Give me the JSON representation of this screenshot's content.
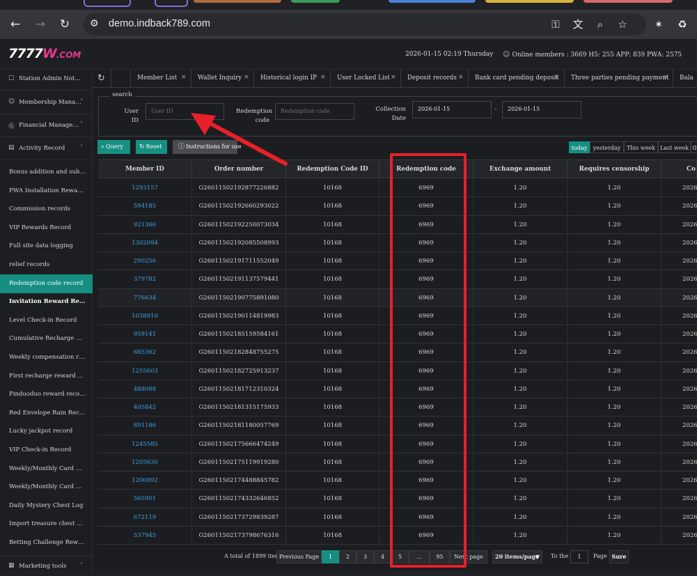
{
  "browser": {
    "url": "demo.indback789.com"
  },
  "header": {
    "logo_main": "7777",
    "logo_w": "W",
    "logo_com": ".COM",
    "datetime": "2026-01-15 02:19 Thursday",
    "online": "Online members : 3669  H5: 255 APP: 839 PWA: 2575"
  },
  "sidebar": {
    "top": [
      {
        "icon": "□",
        "label": "Station Admin Notice"
      },
      {
        "icon": "☺",
        "label": "Membership Manage...",
        "chev": "˅"
      },
      {
        "icon": "Ⓖ",
        "label": "Financial Management",
        "chev": "˅"
      },
      {
        "icon": "▤",
        "label": "Activity Record",
        "chev": "˄"
      }
    ],
    "items": [
      "Bonus addition and subtr...",
      "PWA Installation Reward ...",
      "Commission records",
      "VIP Rewards Record",
      "Full site data logging",
      "relief records",
      "Redemption code record",
      "Invitation Reward Record",
      "Level Check-in Record",
      "Cumulative Recharge Re...",
      "Weekly compensation rec...",
      "First recharge reward record",
      "Pinduoduo reward records",
      "Red Envelope Rain Record",
      "Lucky jackpot record",
      "VIP Check-in Record",
      "Weekly/Monthly Card Pu...",
      "Weekly/Monthly Card Cl...",
      "Daily Mystery Chest Log",
      "Import treasure chest clai...",
      "Betting Challenge Rewards"
    ],
    "bottom": {
      "icon": "▦",
      "label": "Marketing tools",
      "chev": "˅"
    }
  },
  "tabs": [
    {
      "label": "Member List",
      "close": "×"
    },
    {
      "label": "Wallet Inquiry",
      "close": "×"
    },
    {
      "label": "Historical login IP",
      "close": "×"
    },
    {
      "label": "User Locked List",
      "close": "×"
    },
    {
      "label": "Deposit records",
      "close": "×"
    },
    {
      "label": "Bank card pending deposit",
      "close": "×"
    },
    {
      "label": "Three parties pending payment",
      "close": "×"
    },
    {
      "label": "Bala",
      "close": ""
    }
  ],
  "search": {
    "legend": "search",
    "user_id_label": "User ID",
    "user_id_placeholder": "User ID",
    "redemption_label_1": "Redemption",
    "redemption_label_2": "code",
    "redemption_placeholder": "Redemption code",
    "collection_label_1": "Collection",
    "collection_label_2": "Date",
    "date_from": "2026-01-15",
    "date_sep": "-",
    "date_to": "2026-01-15"
  },
  "buttons": {
    "query": "Query",
    "reset": "Reset",
    "instructions": "Instructions for use"
  },
  "date_tabs": [
    "today",
    "yesterday",
    "This week",
    "Last week",
    "th"
  ],
  "table": {
    "headers": [
      "Member ID",
      "Order number",
      "Redemption Code ID",
      "Redemption code",
      "Exchange amount",
      "Requires censorship",
      "Co"
    ],
    "rows": [
      [
        "1293157",
        "G2601150219287722688​2",
        "10168",
        "6969",
        "1.20",
        "1.20",
        "2026-"
      ],
      [
        "594185",
        "G2601150219266029302​2",
        "10168",
        "6969",
        "1.20",
        "1.20",
        "2026-"
      ],
      [
        "921366",
        "G2601150219225007303​4",
        "10168",
        "6969",
        "1.20",
        "1.20",
        "2026-"
      ],
      [
        "1302094",
        "G2601150219208550899​3",
        "10168",
        "6969",
        "1.20",
        "1.20",
        "2026-"
      ],
      [
        "290256",
        "G2601150219171155204​9",
        "10168",
        "6969",
        "1.20",
        "1.20",
        "2026-"
      ],
      [
        "379782",
        "G2601150219113757944​1",
        "10168",
        "6969",
        "1.20",
        "1.20",
        "2026-"
      ],
      [
        "776634",
        "G2601150219077589108​0",
        "10168",
        "6969",
        "1.20",
        "1.20",
        "2026-"
      ],
      [
        "1038910",
        "G2601150219011481998​3",
        "10168",
        "6969",
        "1.20",
        "1.20",
        "2026-"
      ],
      [
        "959141",
        "G2601150218515958416​1",
        "10168",
        "6969",
        "1.20",
        "1.20",
        "2026-"
      ],
      [
        "685362",
        "G2601150218284875527​5",
        "10168",
        "6969",
        "1.20",
        "1.20",
        "2026-"
      ],
      [
        "1255603",
        "G2601150218272591323​7",
        "10168",
        "6969",
        "1.20",
        "1.20",
        "2026-"
      ],
      [
        "488088",
        "G2601150218171231032​4",
        "10168",
        "6969",
        "1.20",
        "1.20",
        "2026-"
      ],
      [
        "405842",
        "G2601150218131517593​3",
        "10168",
        "6969",
        "1.20",
        "1.20",
        "2026-"
      ],
      [
        "891186",
        "G2601150218118005776​9",
        "10168",
        "6969",
        "1.20",
        "1.20",
        "2026-"
      ],
      [
        "1245585",
        "G2601150217566647424​9",
        "10168",
        "6969",
        "1.20",
        "1.20",
        "2026-"
      ],
      [
        "1205630",
        "G2601150217511991928​0",
        "10168",
        "6969",
        "1.20",
        "1.20",
        "2026-"
      ],
      [
        "1200892",
        "G2601150217448884578​2",
        "10168",
        "6969",
        "1.20",
        "1.20",
        "2026-"
      ],
      [
        "565901",
        "G2601150217433264685​2",
        "10168",
        "6969",
        "1.20",
        "1.20",
        "2026-"
      ],
      [
        "672119",
        "G2601150217372983928​7",
        "10168",
        "6969",
        "1.20",
        "1.20",
        "2026-"
      ],
      [
        "537945",
        "G2601150217379867631​6",
        "10168",
        "6969",
        "1.20",
        "1.20",
        "2026-"
      ]
    ]
  },
  "pagination": {
    "total": "A total of 1899 items",
    "prev": "Previous Page",
    "pages": [
      "1",
      "2",
      "3",
      "4",
      "5",
      "...",
      "95"
    ],
    "next": "Next page",
    "size": "20 items/page",
    "to_the": "To the",
    "page_input": "1",
    "page_word": "Page",
    "sure": "Sure"
  },
  "colors": {
    "accent": "#168f82",
    "link": "#3aa4e8",
    "annotation": "#e8202a",
    "logo_pink": "#e4398f"
  }
}
